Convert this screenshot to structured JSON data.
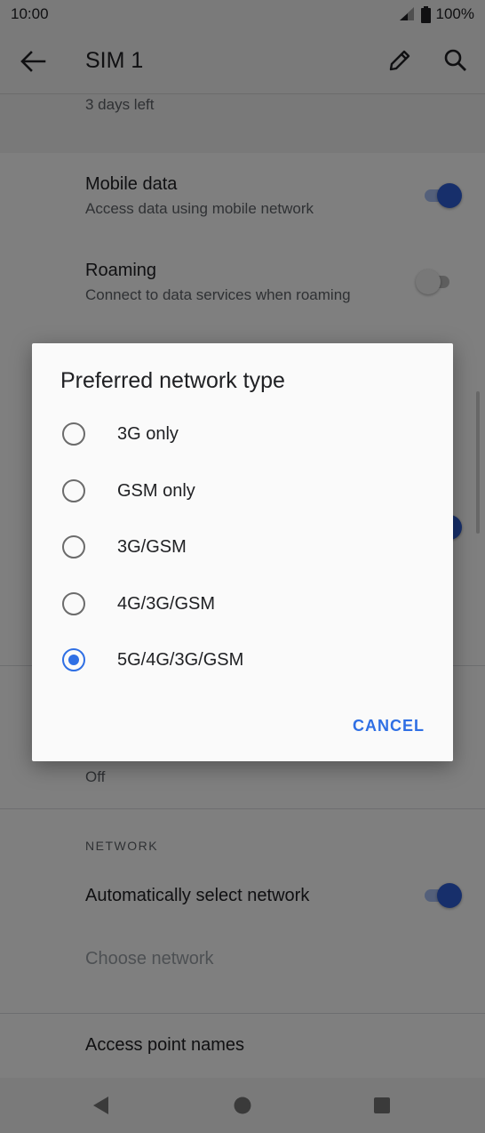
{
  "status_bar": {
    "time": "10:00",
    "battery": "100%"
  },
  "app_bar": {
    "title": "SIM 1"
  },
  "usage": {
    "days_left": "3 days left"
  },
  "settings": {
    "mobile_data": {
      "title": "Mobile data",
      "summary": "Access data using mobile network",
      "enabled": true
    },
    "roaming": {
      "title": "Roaming",
      "summary": "Connect to data services when roaming",
      "enabled": false
    },
    "partial_summary": "Off"
  },
  "network_section": {
    "header": "NETWORK",
    "auto_select": {
      "title": "Automatically select network",
      "enabled": true
    },
    "choose_network": "Choose network",
    "apn": "Access point names"
  },
  "dialog": {
    "title": "Preferred network type",
    "options": [
      {
        "label": "3G only",
        "selected": false
      },
      {
        "label": "GSM only",
        "selected": false
      },
      {
        "label": "3G/GSM",
        "selected": false
      },
      {
        "label": "4G/3G/GSM",
        "selected": false
      },
      {
        "label": "5G/4G/3G/GSM",
        "selected": true
      }
    ],
    "cancel_label": "CANCEL"
  },
  "colors": {
    "accent": "#2f6fe4",
    "switch_on": "#2f5fd7"
  }
}
